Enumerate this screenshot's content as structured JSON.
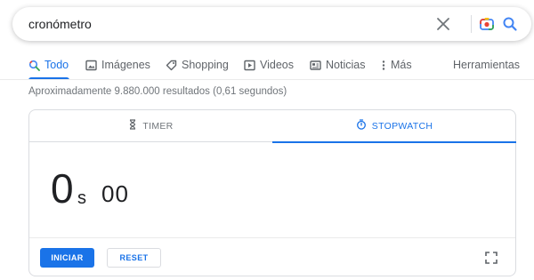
{
  "search": {
    "query": "cronómetro",
    "clear_label": "Borrar",
    "lens_label": "Buscar por imagen",
    "submit_label": "Buscar"
  },
  "tabs": [
    {
      "label": "Todo",
      "icon": "search-icon",
      "active": true
    },
    {
      "label": "Imágenes",
      "icon": "image-icon"
    },
    {
      "label": "Shopping",
      "icon": "tag-icon"
    },
    {
      "label": "Videos",
      "icon": "play-icon"
    },
    {
      "label": "Noticias",
      "icon": "news-icon"
    },
    {
      "label": "Más",
      "icon": "more-vert-icon"
    }
  ],
  "tools_label": "Herramientas",
  "results_stats": "Aproximadamente 9.880.000 resultados (0,61 segundos)",
  "widget": {
    "timer_tab": "TIMER",
    "stopwatch_tab": "STOPWATCH",
    "active_tab": "stopwatch",
    "seconds": "0",
    "seconds_unit": "s",
    "hundredths": "00",
    "start_label": "INICIAR",
    "reset_label": "RESET",
    "fullscreen_icon": "fullscreen-icon"
  },
  "colors": {
    "accent": "#1a73e8",
    "text": "#202124",
    "muted": "#70757a",
    "border": "#dadce0"
  }
}
